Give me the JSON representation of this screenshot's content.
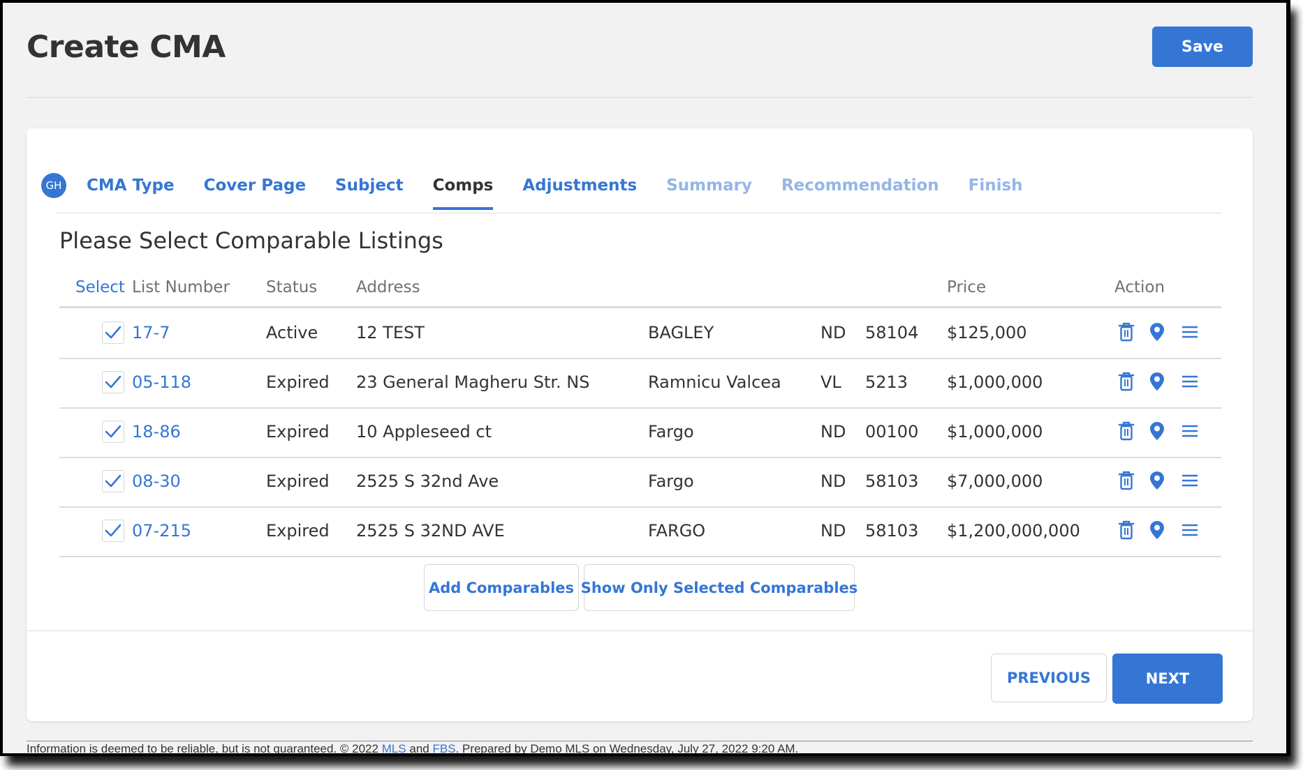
{
  "page": {
    "title": "Create CMA",
    "save_label": "Save"
  },
  "colors": {
    "accent": "#3576d4",
    "disabled_tab": "#94b6e6",
    "text": "#333333"
  },
  "wizard": {
    "avatar_initials": "GH",
    "tabs": [
      {
        "label": "CMA Type",
        "state": "done"
      },
      {
        "label": "Cover Page",
        "state": "done"
      },
      {
        "label": "Subject",
        "state": "done"
      },
      {
        "label": "Comps",
        "state": "active"
      },
      {
        "label": "Adjustments",
        "state": "done"
      },
      {
        "label": "Summary",
        "state": "disabled"
      },
      {
        "label": "Recommendation",
        "state": "disabled"
      },
      {
        "label": "Finish",
        "state": "disabled"
      }
    ]
  },
  "comps": {
    "heading": "Please Select Comparable Listings",
    "columns": {
      "select": "Select",
      "list_number": "List Number",
      "status": "Status",
      "address": "Address",
      "price": "Price",
      "action": "Action"
    },
    "rows": [
      {
        "selected": true,
        "list_number": "17-7",
        "status": "Active",
        "address": "12 TEST",
        "city": "BAGLEY",
        "state": "ND",
        "zip": "58104",
        "price": "$125,000"
      },
      {
        "selected": true,
        "list_number": "05-118",
        "status": "Expired",
        "address": "23 General Magheru Str. NS",
        "city": "Ramnicu Valcea",
        "state": "VL",
        "zip": "5213",
        "price": "$1,000,000"
      },
      {
        "selected": true,
        "list_number": "18-86",
        "status": "Expired",
        "address": "10 Appleseed ct",
        "city": "Fargo",
        "state": "ND",
        "zip": "00100",
        "price": "$1,000,000"
      },
      {
        "selected": true,
        "list_number": "08-30",
        "status": "Expired",
        "address": "2525 S 32nd Ave",
        "city": "Fargo",
        "state": "ND",
        "zip": "58103",
        "price": "$7,000,000"
      },
      {
        "selected": true,
        "list_number": "07-215",
        "status": "Expired",
        "address": "2525 S 32ND AVE",
        "city": "FARGO",
        "state": "ND",
        "zip": "58103",
        "price": "$1,200,000,000"
      }
    ],
    "row_actions": [
      "trash-icon",
      "map-pin-icon",
      "menu-icon"
    ],
    "add_label": "Add Comparables",
    "show_selected_label": "Show Only Selected Comparables"
  },
  "nav": {
    "previous_label": "PREVIOUS",
    "next_label": "NEXT"
  },
  "footer": {
    "text_before": "Information is deemed to be reliable, but is not guaranteed. © 2022 ",
    "link1": "MLS",
    "text_mid": " and ",
    "link2": "FBS",
    "text_after": ". Prepared by Demo MLS on Wednesday, July 27, 2022 9:20 AM."
  }
}
